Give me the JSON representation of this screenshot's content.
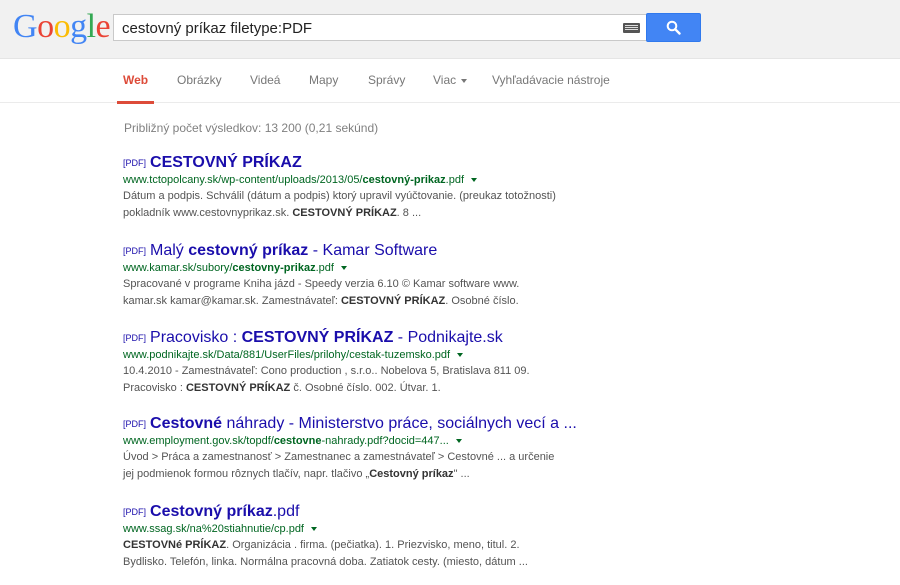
{
  "logo": {
    "letters": [
      "G",
      "o",
      "o",
      "g",
      "l",
      "e"
    ],
    "colors": [
      "#4285f4",
      "#ea4335",
      "#fbbc05",
      "#4285f4",
      "#34a853",
      "#ea4335"
    ]
  },
  "search": {
    "query": "cestovný príkaz filetype:PDF"
  },
  "tabs": [
    {
      "label": "Web"
    },
    {
      "label": "Obrázky"
    },
    {
      "label": "Videá"
    },
    {
      "label": "Mapy"
    },
    {
      "label": "Správy"
    },
    {
      "label": "Viac"
    },
    {
      "label": "Vyhľadávacie nástroje"
    }
  ],
  "stats": "Približný počet výsledkov: 13 200 (0,21 sekúnd)",
  "pdf_tag": "[PDF]",
  "results": [
    {
      "title": [
        {
          "t": "CESTOVNÝ PRÍKAZ",
          "b": true
        }
      ],
      "url": [
        {
          "t": "www.tctopolcany.sk/wp-content/uploads/2013/05/"
        },
        {
          "t": "cestovný-prikaz",
          "b": true
        },
        {
          "t": ".pdf"
        }
      ],
      "snippet1": [
        {
          "t": "Dátum a podpis. Schválil (dátum a podpis) ktorý upravil vyúčtovanie. (preukaz totožnosti)"
        }
      ],
      "snippet2": [
        {
          "t": "pokladník www.cestovnyprikaz.sk. "
        },
        {
          "t": "CESTOVNÝ PRÍKAZ",
          "b": true
        },
        {
          "t": ". 8 ..."
        }
      ]
    },
    {
      "title": [
        {
          "t": "Malý "
        },
        {
          "t": "cestovný príkaz",
          "b": true
        },
        {
          "t": " - Kamar Software"
        }
      ],
      "url": [
        {
          "t": "www.kamar.sk/subory/"
        },
        {
          "t": "cestovny-prikaz",
          "b": true
        },
        {
          "t": ".pdf"
        }
      ],
      "snippet1": [
        {
          "t": "Spracované v programe Kniha jázd - Speedy verzia 6.10 © Kamar software www."
        }
      ],
      "snippet2": [
        {
          "t": "kamar.sk kamar@kamar.sk. Zamestnávateľ: "
        },
        {
          "t": "CESTOVNÝ PRÍKAZ",
          "b": true
        },
        {
          "t": ". Osobné číslo."
        }
      ]
    },
    {
      "title": [
        {
          "t": "Pracovisko : "
        },
        {
          "t": "CESTOVNÝ PRÍKAZ",
          "b": true
        },
        {
          "t": " - Podnikajte.sk"
        }
      ],
      "url": [
        {
          "t": "www.podnikajte.sk/Data/881/UserFiles/prilohy/cestak-tuzemsko.pdf"
        }
      ],
      "snippet1": [
        {
          "t": "10.4.2010 - Zamestnávateľ: Cono production , s.r.o.. Nobelova 5, Bratislava 811 09."
        }
      ],
      "snippet2": [
        {
          "t": "Pracovisko : "
        },
        {
          "t": "CESTOVNÝ PRÍKAZ",
          "b": true
        },
        {
          "t": " č. Osobné číslo. 002. Útvar. 1."
        }
      ]
    },
    {
      "title": [
        {
          "t": "Cestovné",
          "b": true
        },
        {
          "t": " náhrady - Ministerstvo práce, sociálnych vecí a ..."
        }
      ],
      "url": [
        {
          "t": "www.employment.gov.sk/topdf/"
        },
        {
          "t": "cestovne",
          "b": true
        },
        {
          "t": "-nahrady.pdf?docid=447..."
        }
      ],
      "snippet1": [
        {
          "t": "Úvod > Práca a zamestnanosť > Zamestnanec a zamestnávateľ > Cestovné ... a určenie"
        }
      ],
      "snippet2": [
        {
          "t": "jej podmienok formou rôznych tlačív, napr. tlačivo „"
        },
        {
          "t": "Cestovný príkaz",
          "b": true
        },
        {
          "t": "\" ..."
        }
      ]
    },
    {
      "title": [
        {
          "t": "Cestovný príkaz",
          "b": true
        },
        {
          "t": ".pdf"
        }
      ],
      "url": [
        {
          "t": "www.ssag.sk/na%20stiahnutie/cp.pdf"
        }
      ],
      "snippet1": [
        {
          "t": "CESTOVNé PRÍKAZ",
          "b": true
        },
        {
          "t": ". Organizácia . firma. (pečiatka). 1. Priezvisko, meno, titul. 2."
        }
      ],
      "snippet2": [
        {
          "t": "Bydlisko. Telefón, linka. Normálna pracovná doba. Zatiatok cesty. (miesto, dátum  ..."
        }
      ]
    }
  ]
}
